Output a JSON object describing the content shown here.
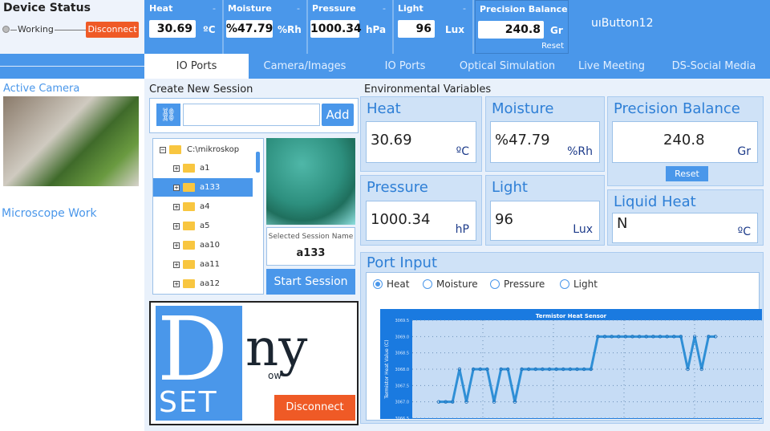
{
  "device": {
    "title": "Device Status",
    "status": "Working",
    "disconnect": "Disconnect"
  },
  "sensors": [
    {
      "label": "Heat",
      "dash": "-",
      "value": "30.69",
      "unit": "ºC"
    },
    {
      "label": "Moisture",
      "dash": "-",
      "value": "%47.79",
      "unit": "%Rh"
    },
    {
      "label": "Pressure",
      "dash": "-",
      "value": "1000.34",
      "unit": "hPa"
    },
    {
      "label": "Light",
      "dash": "-",
      "value": "96",
      "unit": "Lux"
    },
    {
      "label": "Precision Balance",
      "value": "240.8",
      "unit": "Gr",
      "reset": "Reset"
    }
  ],
  "ui_button": "uıButton12",
  "tabs": [
    "IO Ports",
    "Camera/Images",
    "IO Ports",
    "Optical Simulation",
    "Live Meeting",
    "DS-Social Media"
  ],
  "left": {
    "active_camera": "Active Camera",
    "microscope_work": "Microscope Work"
  },
  "session": {
    "title": "Create New Session",
    "input_value": "",
    "add": "Add",
    "root": "C:\\mikroskop",
    "items": [
      "a1",
      "a133",
      "a4",
      "a5",
      "aa10",
      "aa11",
      "aa12"
    ],
    "selected_index": 1,
    "selected_label": "Selected Session Name",
    "selected_value": "a133",
    "start": "Start Session"
  },
  "logo": {
    "text": "DnyowSET",
    "disconnect": "Disconnect"
  },
  "env": {
    "title": "Environmental Variables",
    "heat": {
      "title": "Heat",
      "value": "30.69",
      "unit": "ºC"
    },
    "moisture": {
      "title": "Moisture",
      "value": "%47.79",
      "unit": "%Rh"
    },
    "balance": {
      "title": "Precision Balance",
      "value": "240.8",
      "unit": "Gr",
      "reset": "Reset"
    },
    "pressure": {
      "title": "Pressure",
      "value": "1000.34",
      "unit": "hP"
    },
    "light": {
      "title": "Light",
      "value": "96",
      "unit": "Lux"
    },
    "liquid": {
      "title": "Liquid Heat",
      "value": "N",
      "unit": "ºC"
    }
  },
  "port": {
    "title": "Port Input",
    "options": [
      "Heat",
      "Moisture",
      "Pressure",
      "Light"
    ],
    "selected": "Heat"
  },
  "colors": {
    "accent": "#4a97ea",
    "danger": "#ef5a26",
    "card": "#cfe2f7"
  },
  "chart_data": {
    "type": "line",
    "title": "Termistor Heat Sensor",
    "ylabel": "Termistor Heat Value (C)",
    "ylim": [
      3066.5,
      3069.5
    ],
    "yticks": [
      "3066.5",
      "3067.0",
      "3067.5",
      "3068.0",
      "3068.5",
      "3069.0",
      "3069.5"
    ],
    "grid": true,
    "values": [
      3067,
      3067,
      3067,
      3068,
      3067,
      3068,
      3068,
      3068,
      3067,
      3068,
      3068,
      3067,
      3068,
      3068,
      3068,
      3068,
      3068,
      3068,
      3068,
      3068,
      3068,
      3068,
      3068,
      3069,
      3069,
      3069,
      3069,
      3069,
      3069,
      3069,
      3069,
      3069,
      3069,
      3069,
      3069,
      3069,
      3068,
      3069,
      3068,
      3069,
      3069
    ]
  }
}
